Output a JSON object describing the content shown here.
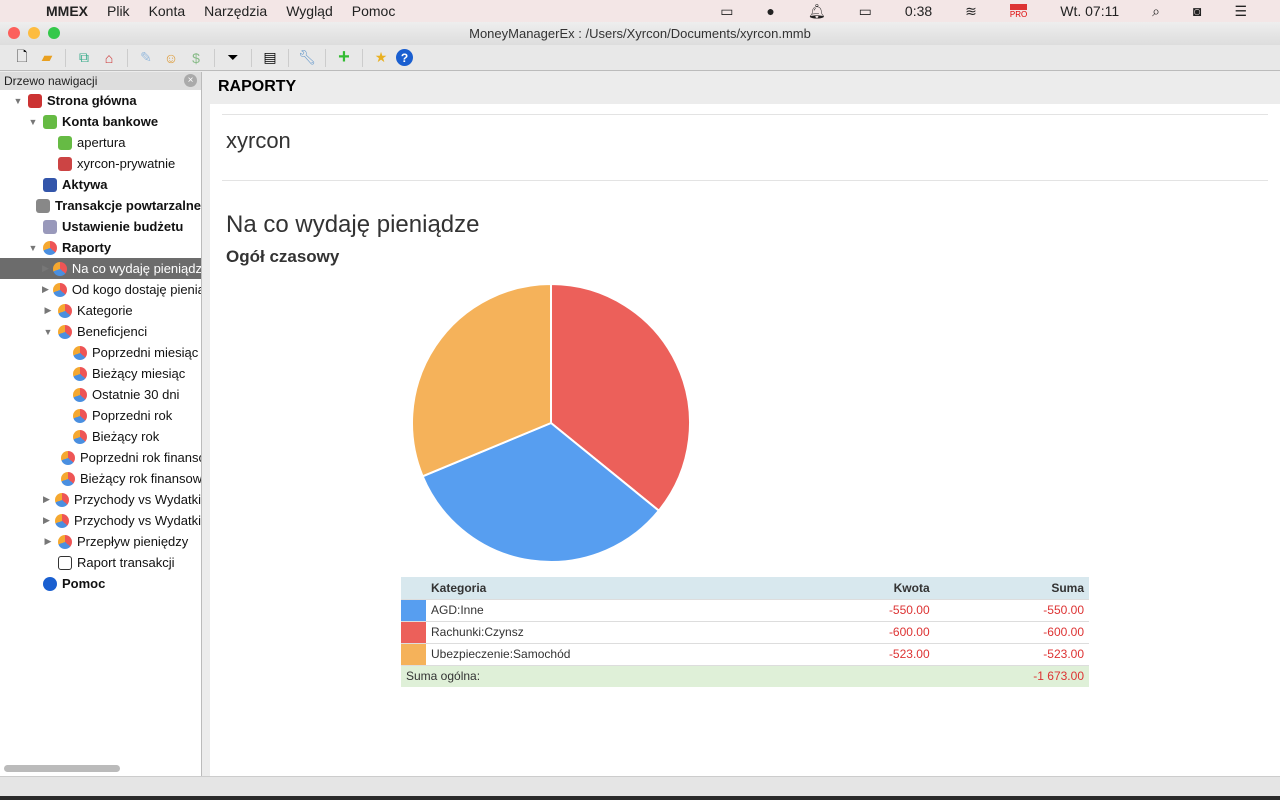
{
  "menubar": {
    "app": "MMEX",
    "items": [
      "Plik",
      "Konta",
      "Narzędzia",
      "Wygląd",
      "Pomoc"
    ],
    "battery": "0:38",
    "clock": "Wt. 07:11",
    "flag_badge": "PRO"
  },
  "window": {
    "title": "MoneyManagerEx : /Users/Xyrcon/Documents/xyrcon.mmb"
  },
  "sidebar": {
    "title": "Drzewo nawigacji",
    "items": [
      {
        "label": "Strona główna",
        "level": 0,
        "bold": true,
        "toggle": "▼",
        "icon": "home"
      },
      {
        "label": "Konta bankowe",
        "level": 1,
        "bold": true,
        "toggle": "▼",
        "icon": "money"
      },
      {
        "label": "apertura",
        "level": 2,
        "icon": "money"
      },
      {
        "label": "xyrcon-prywatnie",
        "level": 2,
        "icon": "money-red"
      },
      {
        "label": "Aktywa",
        "level": 1,
        "bold": true,
        "icon": "car"
      },
      {
        "label": "Transakcje powtarzalne",
        "level": 1,
        "bold": true,
        "icon": "calendar"
      },
      {
        "label": "Ustawienie budżetu",
        "level": 1,
        "bold": true,
        "icon": "budget"
      },
      {
        "label": "Raporty",
        "level": 1,
        "bold": true,
        "toggle": "▼",
        "icon": "pie"
      },
      {
        "label": "Na co wydaję pieniądze",
        "level": 2,
        "toggle": "▶",
        "icon": "pie",
        "selected": true
      },
      {
        "label": "Od kogo dostaję pieniądze",
        "level": 2,
        "toggle": "▶",
        "icon": "pie"
      },
      {
        "label": "Kategorie",
        "level": 2,
        "toggle": "▶",
        "icon": "pie"
      },
      {
        "label": "Beneficjenci",
        "level": 2,
        "toggle": "▼",
        "icon": "pie"
      },
      {
        "label": "Poprzedni miesiąc",
        "level": 3,
        "icon": "pie"
      },
      {
        "label": "Bieżący miesiąc",
        "level": 3,
        "icon": "pie"
      },
      {
        "label": "Ostatnie 30 dni",
        "level": 3,
        "icon": "pie"
      },
      {
        "label": "Poprzedni rok",
        "level": 3,
        "icon": "pie"
      },
      {
        "label": "Bieżący rok",
        "level": 3,
        "icon": "pie"
      },
      {
        "label": "Poprzedni rok finansowy",
        "level": 3,
        "icon": "pie"
      },
      {
        "label": "Bieżący rok finansowy",
        "level": 3,
        "icon": "pie"
      },
      {
        "label": "Przychody vs Wydatki",
        "level": 2,
        "toggle": "▶",
        "icon": "pie"
      },
      {
        "label": "Przychody vs Wydatki",
        "level": 2,
        "toggle": "▶",
        "icon": "pie"
      },
      {
        "label": "Przepływ pieniędzy",
        "level": 2,
        "toggle": "▶",
        "icon": "pie"
      },
      {
        "label": "Raport transakcji",
        "level": 2,
        "icon": "filter"
      },
      {
        "label": "Pomoc",
        "level": 1,
        "bold": true,
        "icon": "help"
      }
    ]
  },
  "main": {
    "header": "RAPORTY",
    "user": "xyrcon",
    "report_title": "Na co wydaję pieniądze",
    "period": "Ogół czasowy"
  },
  "table": {
    "headers": [
      "Kategoria",
      "Kwota",
      "Suma"
    ],
    "rows": [
      {
        "category": "AGD:Inne",
        "amount": "-550.00",
        "sum": "-550.00",
        "color": "#579ef0"
      },
      {
        "category": "Rachunki:Czynsz",
        "amount": "-600.00",
        "sum": "-600.00",
        "color": "#ec605a"
      },
      {
        "category": "Ubezpieczenie:Samochód",
        "amount": "-523.00",
        "sum": "-523.00",
        "color": "#f5b25a"
      }
    ],
    "total_label": "Suma ogólna:",
    "total": "-1 673.00"
  },
  "chart_data": {
    "type": "pie",
    "categories": [
      "Rachunki:Czynsz",
      "AGD:Inne",
      "Ubezpieczenie:Samochód"
    ],
    "values": [
      600,
      550,
      523
    ],
    "colors": [
      "#ec605a",
      "#579ef0",
      "#f5b25a"
    ],
    "start": "top",
    "direction": "clockwise"
  }
}
